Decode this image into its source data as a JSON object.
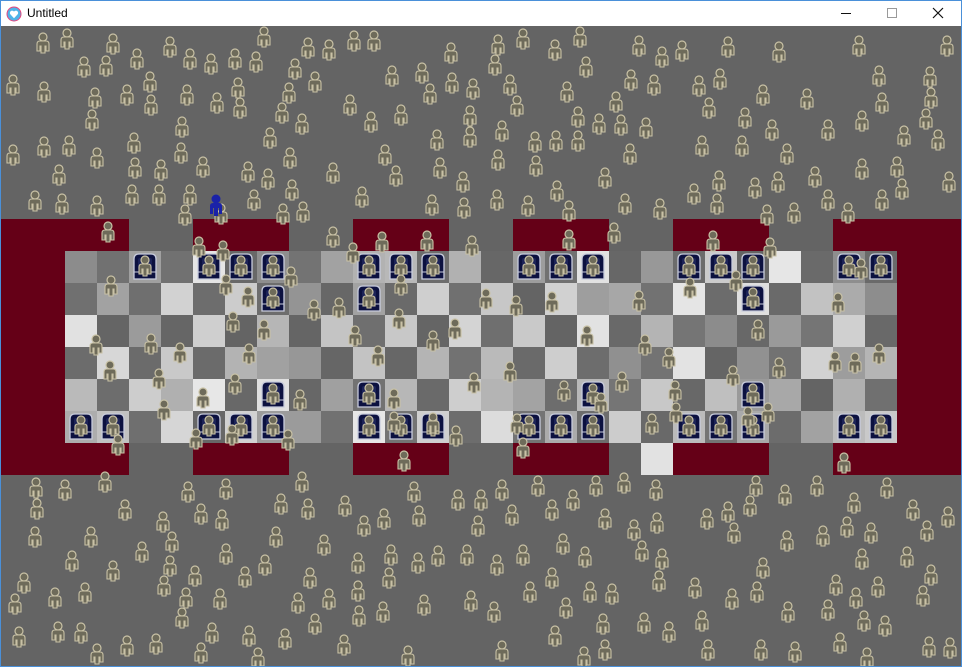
{
  "window": {
    "title": "Untitled",
    "app_icon": "heart-icon",
    "controls": {
      "minimize": "minimize-icon",
      "maximize": "maximize-icon",
      "close": "close-icon"
    }
  },
  "scene": {
    "colors": {
      "background": "#646464",
      "stand": "#650017",
      "seat": "#0c1140",
      "person": "#6e6b5a",
      "player": "#1a22a8"
    },
    "icons": [
      "person-icon",
      "seat-icon",
      "player-icon"
    ]
  }
}
